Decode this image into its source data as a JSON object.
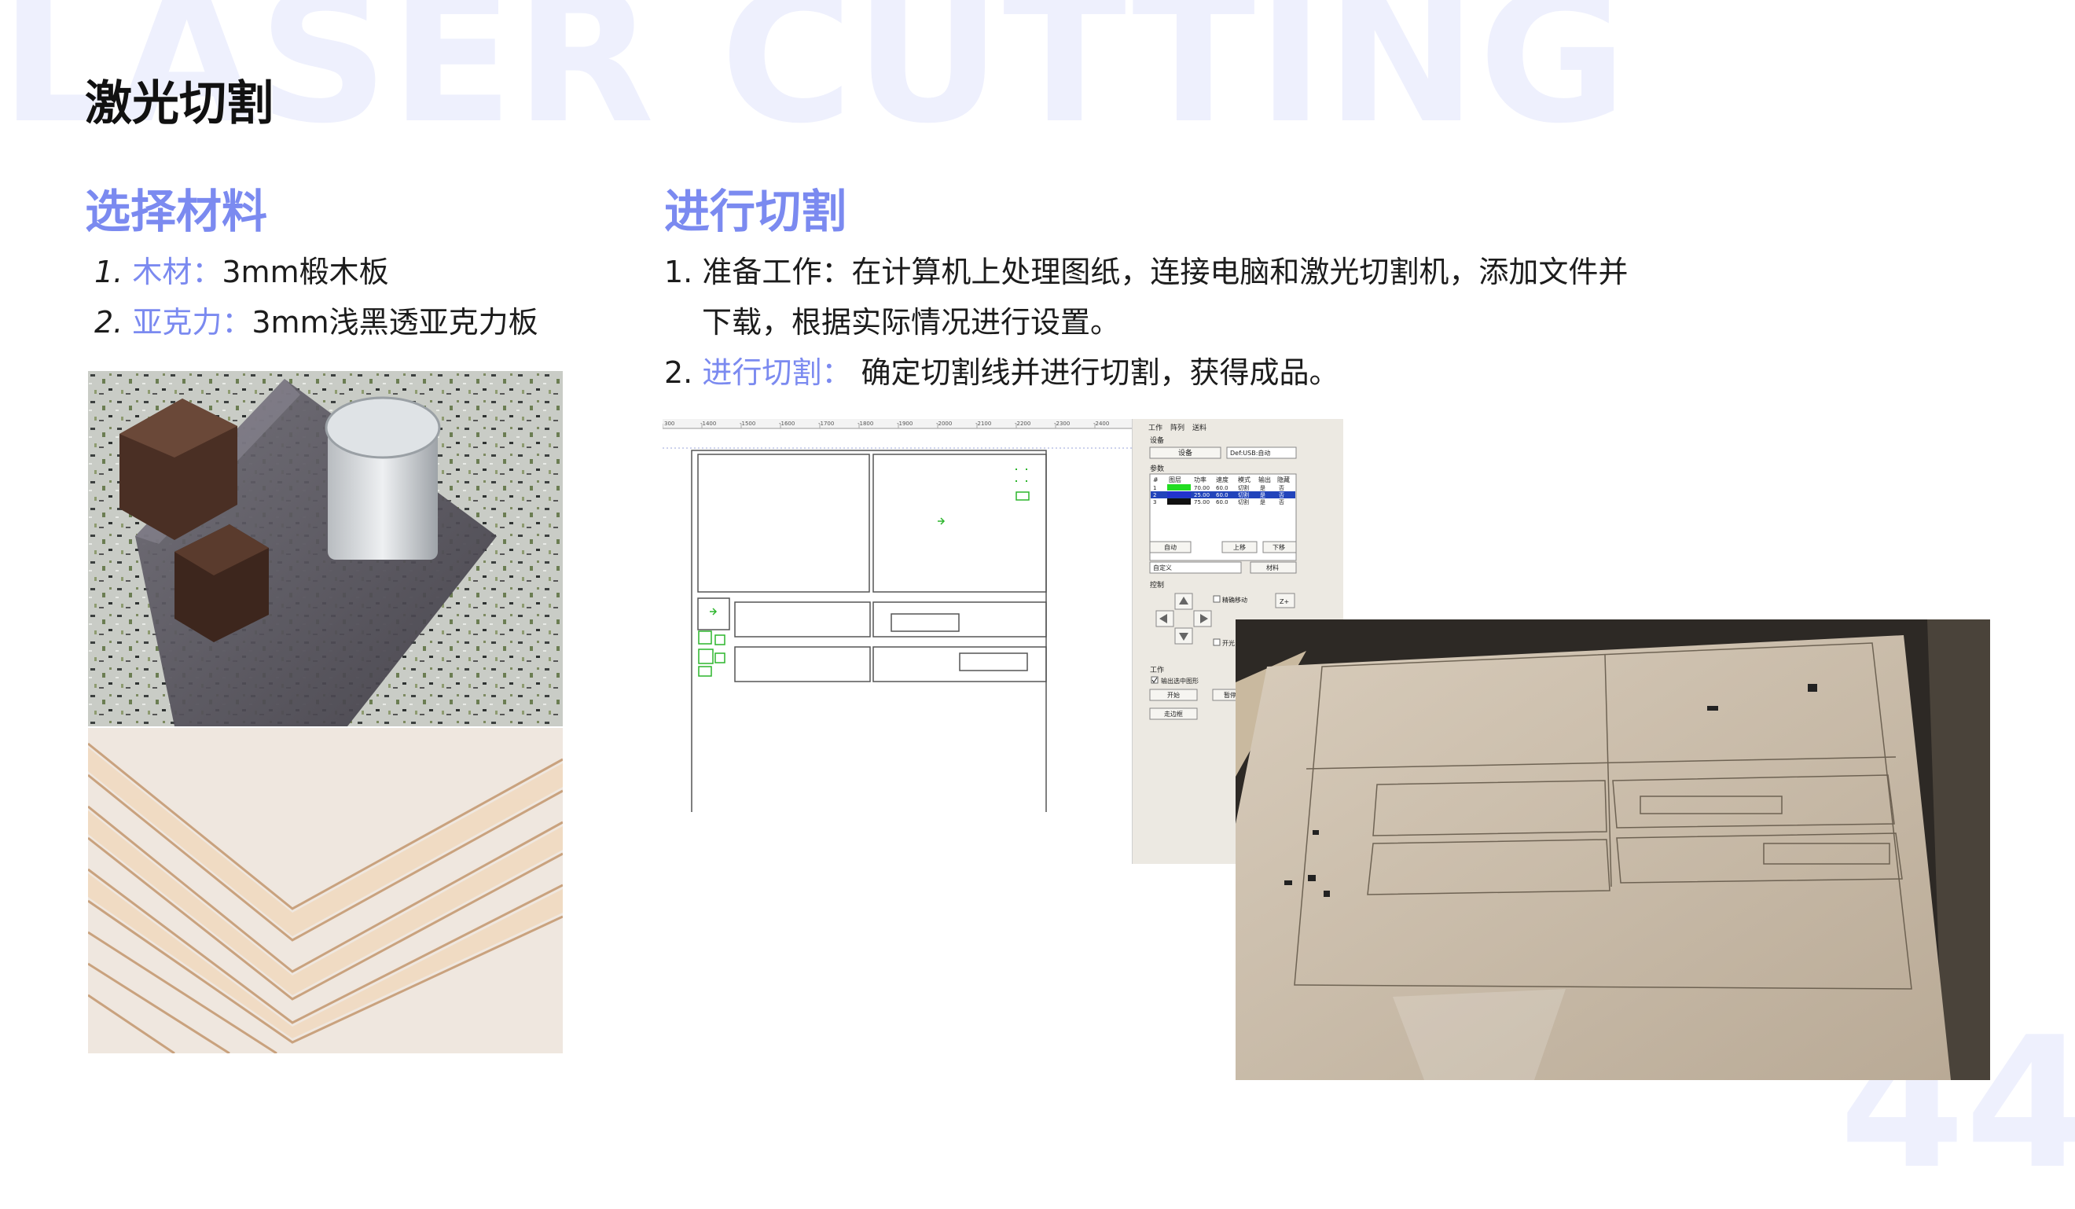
{
  "background": {
    "word": "LASER CUTTING",
    "page_number": "44"
  },
  "header": {
    "title": "激光切割"
  },
  "left": {
    "heading": "选择材料",
    "items": [
      {
        "num": "1.",
        "label": "木材：",
        "text": "3mm椴木板"
      },
      {
        "num": "2.",
        "label": "亚克力：",
        "text": "3mm浅黑透亚克力板"
      }
    ]
  },
  "right": {
    "heading": "进行切割",
    "items": [
      {
        "num": "1.",
        "text_line1": "准备工作：在计算机上处理图纸，连接电脑和激光切割机，添加文件并",
        "text_line2": "下载，根据实际情况进行设置。"
      },
      {
        "num": "2.",
        "label": "进行切割：",
        "text": " 确定切割线并进行切割，获得成品。"
      }
    ]
  },
  "software": {
    "ruler_ticks": [
      "300",
      "-1400",
      "-1500",
      "-1600",
      "-1700",
      "-1800",
      "-1900",
      "-2000",
      "-2100",
      "-2200",
      "-2300",
      "-2400"
    ],
    "tabs": [
      "工作",
      "阵列",
      "送料"
    ],
    "section_device": "设备",
    "device_button": "设备",
    "device_select": "Def:USB:自动",
    "section_params": "参数",
    "table_headers": [
      "#",
      "图层",
      "功率",
      "速度",
      "模式",
      "输出",
      "隐藏"
    ],
    "table_rows": [
      [
        "1",
        "",
        "70.00",
        "60.0",
        "切割",
        "是",
        "否"
      ],
      [
        "2",
        "",
        "25.00",
        "60.0",
        "切割",
        "是",
        "否"
      ],
      [
        "3",
        "",
        "75.00",
        "60.0",
        "切割",
        "是",
        "否"
      ]
    ],
    "layer_colors": [
      "#22dd22",
      "#2233cc",
      "#111111"
    ],
    "buttons_row1": [
      "自动",
      "上移",
      "下移"
    ],
    "custom_select": "自定义",
    "material_button": "材料",
    "section_control": "控制",
    "check_fine_move": "精确移动",
    "check_laser": "开光",
    "z_up": "Z+",
    "section_work": "工作",
    "check_output_selected": "输出选中图形",
    "btn_start": "开始",
    "btn_pause": "暂停",
    "btn_frame": "走边框"
  },
  "colors": {
    "accent": "#7b8af0",
    "bg_text": "#eef0fd"
  }
}
